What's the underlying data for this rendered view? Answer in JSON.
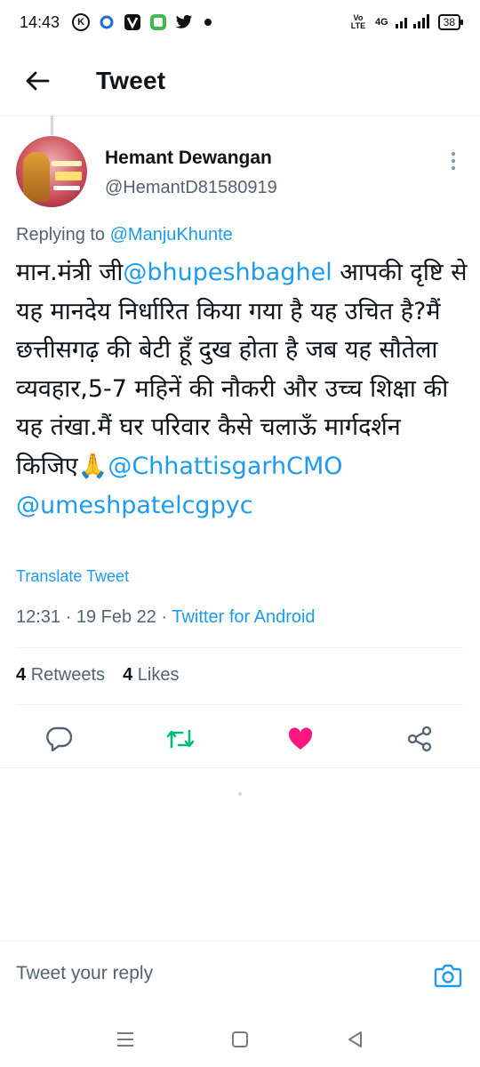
{
  "status_bar": {
    "time": "14:43",
    "k_badge": "K",
    "network": "4G",
    "volte": "Vo LTE",
    "battery": "38",
    "icons": [
      "k-icon",
      "circle-app-icon",
      "vmate-icon",
      "app-square-icon",
      "twitter-bird-icon",
      "notification-dot-icon"
    ]
  },
  "header": {
    "title": "Tweet"
  },
  "tweet": {
    "author_name": "Hemant Dewangan",
    "author_handle": "@HemantD81580919",
    "replying_prefix": "Replying to",
    "replying_handle": "@ManjuKhunte",
    "text_parts": {
      "p1": "मान.मंत्री जी",
      "m1": "@bhupeshbaghel",
      "p2": " आपकी दृष्टि से यह मानदेय निर्धारित किया गया है यह उचित है?मैं छत्तीसगढ़ की बेटी हूँ दुख होता है जब यह सौतेला व्यवहार,5-7 महिनें की नौकरी और उच्च शिक्षा की यह तंखा.मैं घर परिवार कैसे चलाऊँ मार्गदर्शन किजिए🙏",
      "m2": "@ChhattisgarhCMO",
      "m3": "@umeshpatelcgpyc"
    },
    "translate_label": "Translate Tweet",
    "time": "12:31",
    "date": "19 Feb 22",
    "separator": "·",
    "source": "Twitter for Android",
    "retweets_count": "4",
    "retweets_label": "Retweets",
    "likes_count": "4",
    "likes_label": "Likes",
    "liked": true
  },
  "actions": [
    "reply-icon",
    "retweet-icon",
    "like-icon",
    "share-icon"
  ],
  "colors": {
    "accent": "#1d9bf0",
    "retweet": "#00ba7c",
    "like": "#f91880",
    "muted": "#536471"
  },
  "reply_bar": {
    "placeholder": "Tweet your reply"
  },
  "nav_bar": [
    "menu-icon",
    "home-square-icon",
    "back-triangle-icon"
  ]
}
